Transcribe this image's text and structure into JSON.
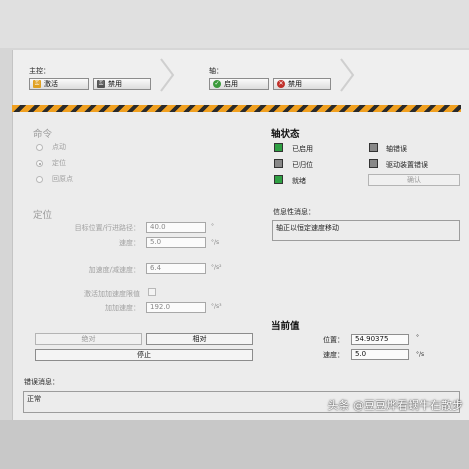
{
  "main_control": {
    "label": "主控：",
    "activate_label": "激活",
    "disable_label": "禁用"
  },
  "axis_control": {
    "label": "轴：",
    "enable_label": "启用",
    "disable_label": "禁用"
  },
  "command": {
    "heading": "命令",
    "options": [
      "点动",
      "定位",
      "回原点"
    ],
    "selected": "定位"
  },
  "positioning": {
    "heading": "定位",
    "target_label": "目标位置/行进路径：",
    "target_value": "40.0",
    "target_unit": "°",
    "speed_label": "速度：",
    "speed_value": "5.0",
    "speed_unit": "°/s",
    "accel_label": "加速度/减速度：",
    "accel_value": "6.4",
    "accel_unit": "°/s²",
    "jerk_enable_label": "激活加加速度限值",
    "jerk_label": "加加速度：",
    "jerk_value": "192.0",
    "jerk_unit": "°/s³",
    "absolute_label": "绝对",
    "relative_label": "相对",
    "stop_label": "停止"
  },
  "axis_status": {
    "heading": "轴状态",
    "items": [
      {
        "label": "已启用",
        "on": true
      },
      {
        "label": "已归位",
        "on": false
      },
      {
        "label": "就绪",
        "on": true
      },
      {
        "label": "轴错误",
        "on": false
      },
      {
        "label": "驱动装置错误",
        "on": false
      }
    ],
    "confirm_label": "确认"
  },
  "info": {
    "label": "信息性消息：",
    "message": "轴正以恒定速度移动"
  },
  "current_values": {
    "heading": "当前值",
    "position_label": "位置：",
    "position_value": "54.90375",
    "position_unit": "°",
    "speed_label": "速度：",
    "speed_value": "5.0",
    "speed_unit": "°/s"
  },
  "error": {
    "label": "错误消息：",
    "message": "正常"
  },
  "watermark": "头条 @豆豆烨看蜗牛在散步",
  "colors": {
    "stripe_orange": "#f0a020",
    "led_green": "#2fa043",
    "icon_green": "#3a9a3a",
    "icon_red": "#c0302a"
  }
}
